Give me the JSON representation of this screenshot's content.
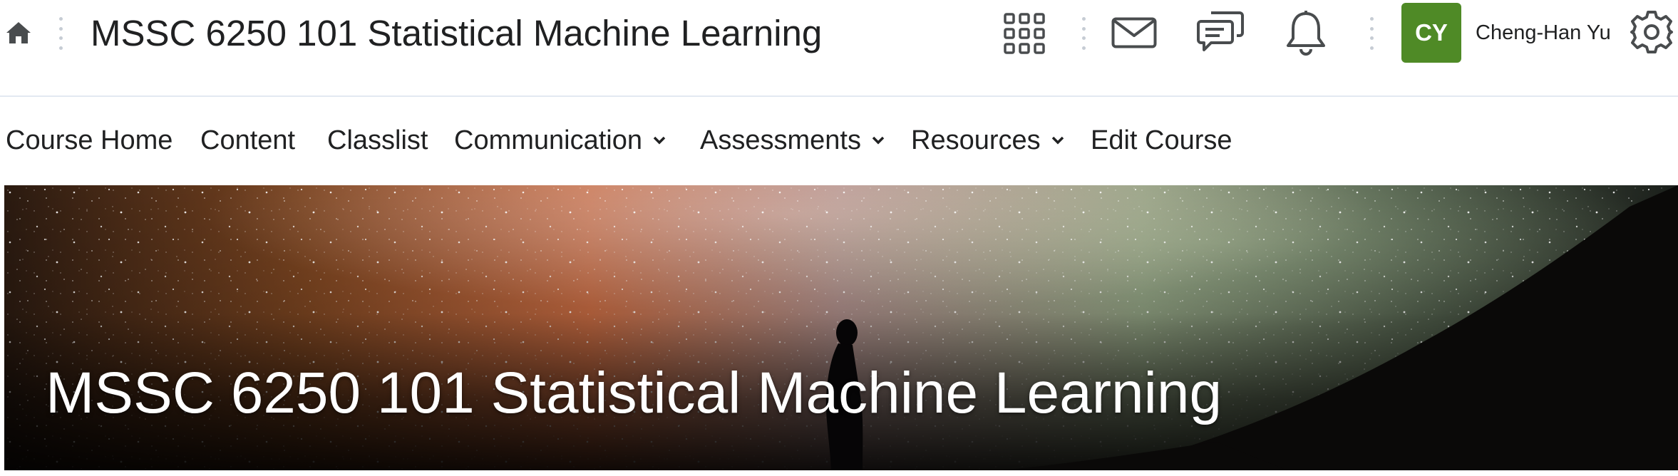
{
  "header": {
    "course_title": "MSSC 6250 101 Statistical Machine Learning",
    "icons": [
      "home-icon",
      "apps-grid-icon",
      "mail-icon",
      "chat-icon",
      "bell-icon",
      "gear-icon"
    ],
    "user": {
      "initials": "CY",
      "name": "Cheng-Han Yu",
      "avatar_color": "#4f8a26"
    }
  },
  "nav": {
    "items": [
      {
        "label": "Course Home",
        "dropdown": false
      },
      {
        "label": "Content",
        "dropdown": false
      },
      {
        "label": "Classlist",
        "dropdown": false
      },
      {
        "label": "Communication",
        "dropdown": true
      },
      {
        "label": "Assessments",
        "dropdown": true
      },
      {
        "label": "Resources",
        "dropdown": true
      },
      {
        "label": "Edit Course",
        "dropdown": false
      }
    ]
  },
  "banner": {
    "title": "MSSC 6250 101 Statistical Machine Learning",
    "image": "starry-night-silhouette"
  },
  "colors": {
    "text": "#202122",
    "divider": "#e3e9f1",
    "avatar": "#4f8a26"
  }
}
